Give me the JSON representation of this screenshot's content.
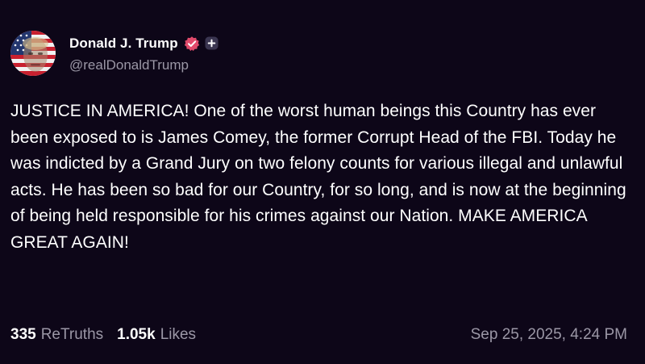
{
  "author": {
    "display_name": "Donald J. Trump",
    "handle": "@realDonaldTrump",
    "verified_icon": "verified-badge-icon",
    "plus_icon": "plus-icon",
    "verified_color": "#e04a6b"
  },
  "post": {
    "text": "JUSTICE IN AMERICA! One of the worst human beings this Country has ever been exposed to is James Comey, the former Corrupt Head of the FBI. Today he was indicted by a Grand Jury on two felony counts for various illegal and unlawful acts. He has been so bad for our Country, for so long, and is now at the beginning of being held responsible for his crimes against our Nation. MAKE AMERICA GREAT AGAIN!"
  },
  "stats": {
    "retruths_count": "335",
    "retruths_label": "ReTruths",
    "likes_count": "1.05k",
    "likes_label": "Likes"
  },
  "timestamp": "Sep 25, 2025, 4:24 PM",
  "colors": {
    "background": "#0d0618",
    "text": "#ffffff",
    "muted": "#9b97a6"
  }
}
